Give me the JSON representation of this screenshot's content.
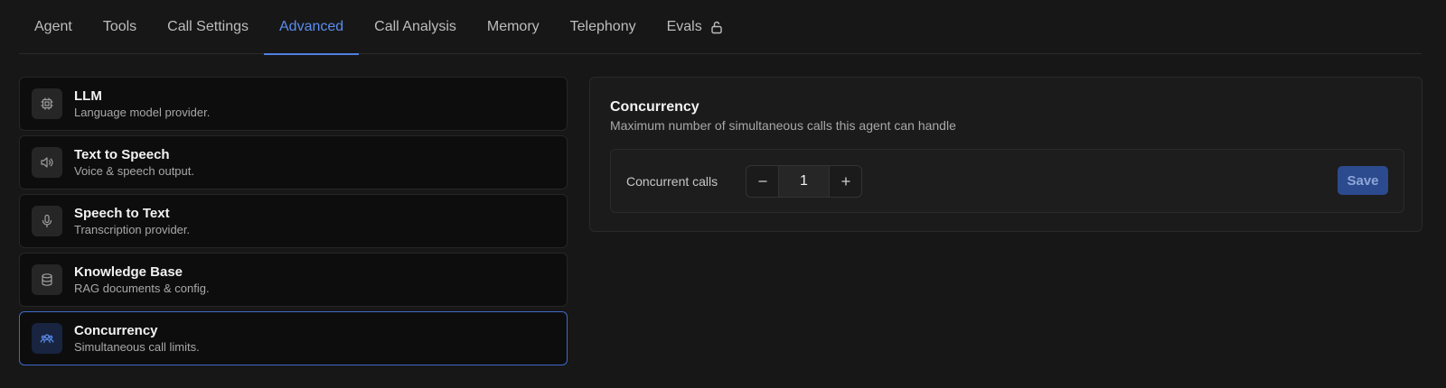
{
  "tabs": [
    {
      "label": "Agent",
      "active": false
    },
    {
      "label": "Tools",
      "active": false
    },
    {
      "label": "Call Settings",
      "active": false
    },
    {
      "label": "Advanced",
      "active": true
    },
    {
      "label": "Call Analysis",
      "active": false
    },
    {
      "label": "Memory",
      "active": false
    },
    {
      "label": "Telephony",
      "active": false
    },
    {
      "label": "Evals",
      "active": false,
      "icon": "lock-icon"
    }
  ],
  "sections": [
    {
      "title": "LLM",
      "subtitle": "Language model provider.",
      "icon": "chip-icon"
    },
    {
      "title": "Text to Speech",
      "subtitle": "Voice & speech output.",
      "icon": "speaker-icon"
    },
    {
      "title": "Speech to Text",
      "subtitle": "Transcription provider.",
      "icon": "microphone-icon"
    },
    {
      "title": "Knowledge Base",
      "subtitle": "RAG documents & config.",
      "icon": "database-icon"
    },
    {
      "title": "Concurrency",
      "subtitle": "Simultaneous call limits.",
      "icon": "users-icon",
      "active": true
    }
  ],
  "panel": {
    "title": "Concurrency",
    "description": "Maximum number of simultaneous calls this agent can handle",
    "setting_label": "Concurrent calls",
    "value": "1",
    "save_label": "Save"
  },
  "colors": {
    "accent": "#4f7fe0",
    "background": "#171717",
    "save_button": "#2c4a8e"
  }
}
